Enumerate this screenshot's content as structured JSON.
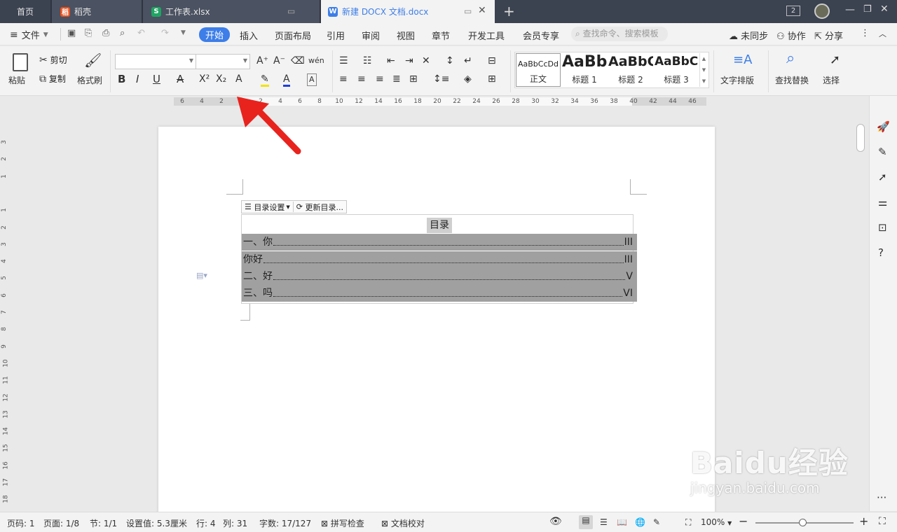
{
  "tabs": {
    "home": "首页",
    "daoke": "稻壳",
    "xlsx": "工作表.xlsx",
    "docx": "新建 DOCX 文档.docx",
    "new_tab": "+",
    "window_count": "2"
  },
  "menu": {
    "file": "文件",
    "items": [
      "开始",
      "插入",
      "页面布局",
      "引用",
      "审阅",
      "视图",
      "章节",
      "开发工具",
      "会员专享"
    ],
    "search_placeholder": "查找命令、搜索模板",
    "sync": "未同步",
    "collab": "协作",
    "share": "分享"
  },
  "ribbon": {
    "paste": "粘贴",
    "cut": "剪切",
    "copy": "复制",
    "format_painter": "格式刷",
    "font_name": "",
    "font_size": "",
    "styles": [
      {
        "sample": "AaBbCcDd",
        "name": "正文"
      },
      {
        "sample": "AaBb",
        "name": "标题 1"
      },
      {
        "sample": "AaBbC",
        "name": "标题 2"
      },
      {
        "sample": "AaBbCc",
        "name": "标题 3"
      }
    ],
    "text_layout": "文字排版",
    "find_replace": "查找替换",
    "select": "选择"
  },
  "ruler": {
    "h_ticks": [
      "6",
      "4",
      "2",
      "",
      "2",
      "4",
      "6",
      "8",
      "10",
      "12",
      "14",
      "16",
      "18",
      "20",
      "22",
      "24",
      "26",
      "28",
      "30",
      "32",
      "34",
      "36",
      "38",
      "40",
      "42",
      "44",
      "46"
    ],
    "v_ticks": [
      "3",
      "2",
      "1",
      "",
      "1",
      "2",
      "3",
      "4",
      "5",
      "6",
      "7",
      "8",
      "9",
      "10",
      "11",
      "12",
      "13",
      "14",
      "15",
      "16",
      "17",
      "18"
    ]
  },
  "document": {
    "toc_settings": "目录设置",
    "toc_update": "更新目录...",
    "toc_title": "目录",
    "toc_entries": [
      {
        "text": "一、你",
        "page": "III"
      },
      {
        "text": "你好",
        "page": "III"
      },
      {
        "text": "二、好",
        "page": "V"
      },
      {
        "text": "三、吗",
        "page": "VI"
      }
    ]
  },
  "status": {
    "page_no": "页码: 1",
    "pages": "页面: 1/8",
    "section": "节: 1/1",
    "setting": "设置值: 5.3厘米",
    "row": "行: 4",
    "col": "列: 31",
    "words": "字数: 17/127",
    "spell": "拼写检查",
    "proof": "文档校对",
    "zoom": "100%"
  },
  "watermark": {
    "brand": "Baidu经验",
    "url": "jingyan.baidu.com"
  },
  "colors": {
    "accent": "#3d7ee8",
    "tabbar": "#3b4250",
    "arrow": "#e8231d",
    "toc_highlight": "#a0a0a0"
  }
}
